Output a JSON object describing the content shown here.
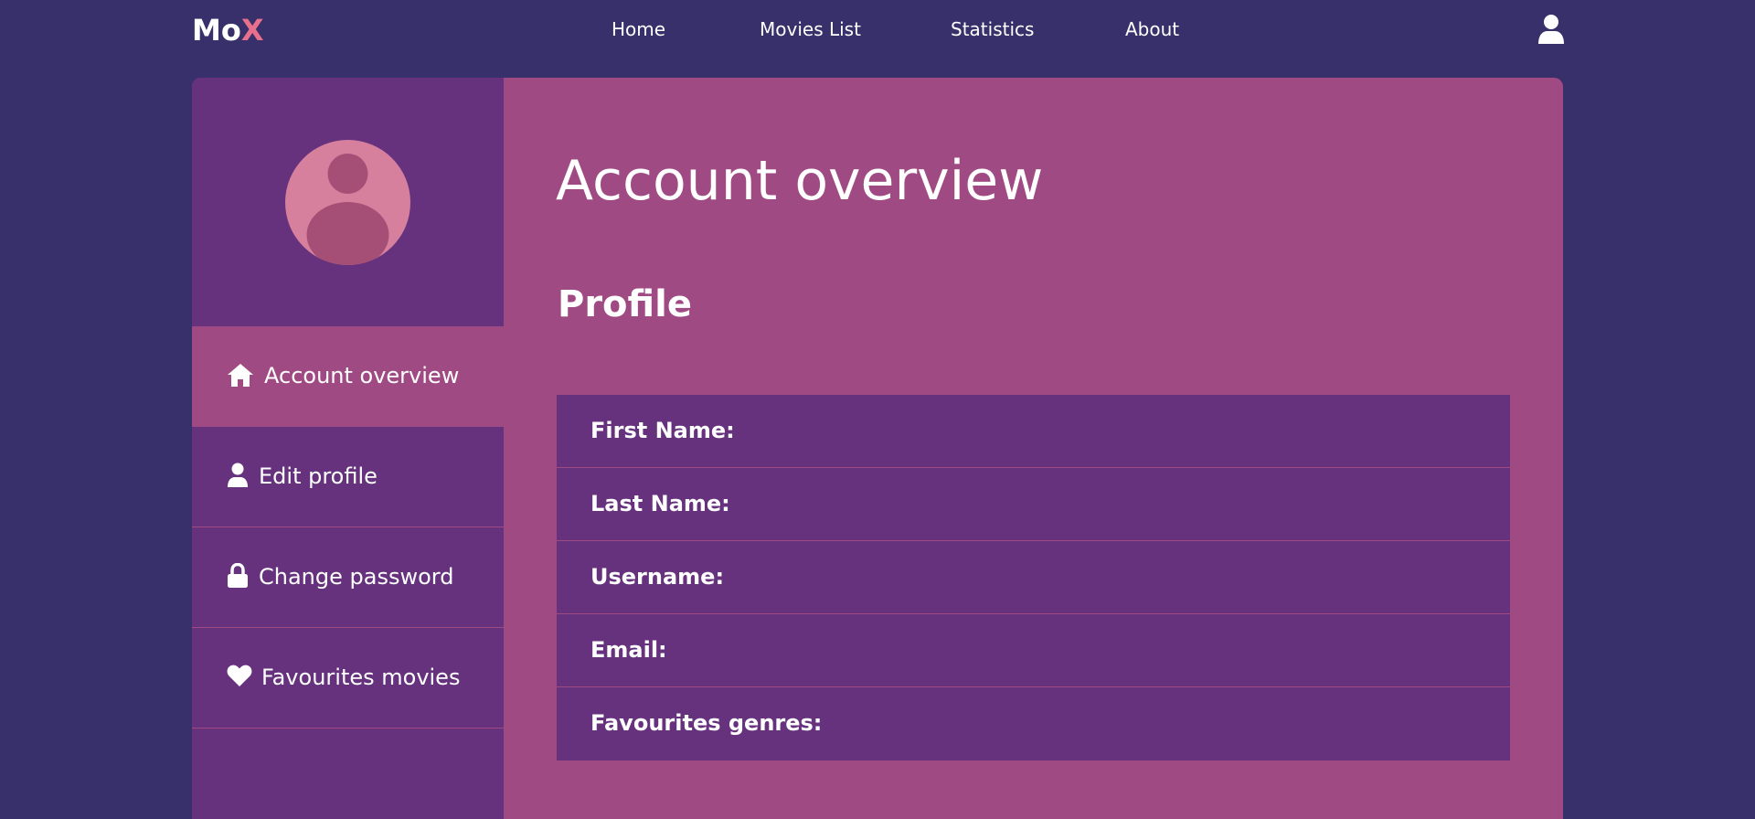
{
  "brand": {
    "name_main": "Mo",
    "name_accent": "X",
    "accent_color": "#e8708c"
  },
  "nav": {
    "links": [
      {
        "label": "Home"
      },
      {
        "label": "Movies List"
      },
      {
        "label": "Statistics"
      },
      {
        "label": "About"
      }
    ],
    "user_icon": "user-icon"
  },
  "colors": {
    "background": "#37306a",
    "sidebar": "#66327d",
    "panel": "#a04a84",
    "avatar_circle": "#d6809e",
    "avatar_figure": "#a54f76"
  },
  "sidebar": {
    "avatar_icon": "avatar-placeholder-icon",
    "items": [
      {
        "label": "Account overview",
        "icon": "home-icon",
        "active": true
      },
      {
        "label": "Edit profile",
        "icon": "user-icon",
        "active": false
      },
      {
        "label": "Change password",
        "icon": "lock-icon",
        "active": false
      },
      {
        "label": "Favourites movies",
        "icon": "heart-icon",
        "active": false
      }
    ]
  },
  "main": {
    "title": "Account overview",
    "section_title": "Profile",
    "profile_rows": [
      {
        "label": "First Name:",
        "value": ""
      },
      {
        "label": "Last Name:",
        "value": ""
      },
      {
        "label": "Username:",
        "value": ""
      },
      {
        "label": "Email:",
        "value": ""
      },
      {
        "label": "Favourites genres:",
        "value": ""
      }
    ]
  }
}
